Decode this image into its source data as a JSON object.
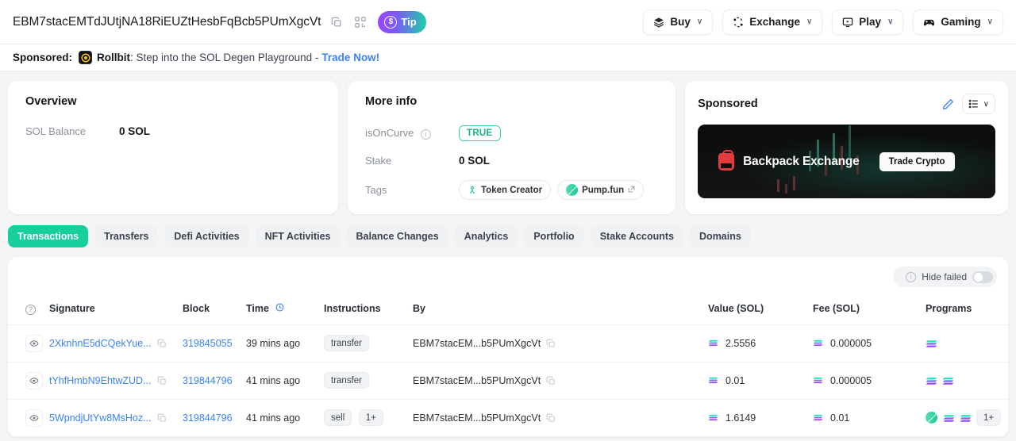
{
  "header": {
    "address": "EBM7stacEMTdJUtjNA18RiEUZtHesbFqBcb5PUmXgcVt",
    "copy_icon": "copy-icon",
    "qr_icon": "qr-code-icon",
    "tip_label": "Tip",
    "tip_coin": "$",
    "nav": [
      {
        "label": "Buy",
        "icon": "card-stack-icon"
      },
      {
        "label": "Exchange",
        "icon": "exchange-icon"
      },
      {
        "label": "Play",
        "icon": "play-monitor-icon"
      },
      {
        "label": "Gaming",
        "icon": "gamepad-icon"
      }
    ],
    "chevron": "∨"
  },
  "sponsor_strip": {
    "prefix": "Sponsored:",
    "brand": "Rollbit",
    "text": ": Step into the SOL Degen Playground -",
    "cta": "Trade Now!"
  },
  "overview": {
    "title": "Overview",
    "rows": [
      {
        "key": "SOL Balance",
        "value": "0 SOL"
      }
    ]
  },
  "more_info": {
    "title": "More info",
    "is_on_curve_label": "isOnCurve",
    "is_on_curve_value": "TRUE",
    "stake_label": "Stake",
    "stake_value": "0 SOL",
    "tags_label": "Tags",
    "tags": [
      {
        "label": "Token Creator",
        "icon": "token-creator-icon",
        "external": false
      },
      {
        "label": "Pump.fun",
        "icon": "pump-fun-icon",
        "external": true
      }
    ]
  },
  "sponsored_card": {
    "title": "Sponsored",
    "edit_icon": "pencil-icon",
    "list_icon": "list-icon",
    "chevron": "∨",
    "ad_name": "Backpack Exchange",
    "ad_button": "Trade Crypto"
  },
  "tabs": [
    {
      "label": "Transactions",
      "active": true
    },
    {
      "label": "Transfers",
      "active": false
    },
    {
      "label": "Defi Activities",
      "active": false
    },
    {
      "label": "NFT Activities",
      "active": false
    },
    {
      "label": "Balance Changes",
      "active": false
    },
    {
      "label": "Analytics",
      "active": false
    },
    {
      "label": "Portfolio",
      "active": false
    },
    {
      "label": "Stake Accounts",
      "active": false
    },
    {
      "label": "Domains",
      "active": false
    }
  ],
  "table": {
    "hide_failed_label": "Hide failed",
    "hide_failed_on": false,
    "columns": [
      "",
      "Signature",
      "Block",
      "Time",
      "Instructions",
      "By",
      "Value (SOL)",
      "Fee (SOL)",
      "Programs"
    ],
    "rows": [
      {
        "signature": "2XknhnE5dCQekYue...",
        "block": "319845055",
        "time": "39 mins ago",
        "instructions": [
          "transfer"
        ],
        "by": "EBM7stacEM...b5PUmXgcVt",
        "value": "2.5556",
        "fee": "0.000005",
        "programs": [
          "sol"
        ]
      },
      {
        "signature": "tYhfHmbN9EhtwZUD...",
        "block": "319844796",
        "time": "41 mins ago",
        "instructions": [
          "transfer"
        ],
        "by": "EBM7stacEM...b5PUmXgcVt",
        "value": "0.01",
        "fee": "0.000005",
        "programs": [
          "sol",
          "sol"
        ]
      },
      {
        "signature": "5WpndjUtYw8MsHoz...",
        "block": "319844796",
        "time": "41 mins ago",
        "instructions": [
          "sell",
          "1+"
        ],
        "by": "EBM7stacEM...b5PUmXgcVt",
        "value": "1.6149",
        "fee": "0.01",
        "programs": [
          "pump",
          "sol",
          "sol",
          "1+"
        ]
      }
    ]
  },
  "colors": {
    "accent_green": "#17cf9d",
    "link_blue": "#3b82f6",
    "tip_gradient_from": "#9945ff",
    "tip_gradient_to": "#19d4a6",
    "ad_red": "#e33b3b",
    "page_bg": "#f4f5f7"
  }
}
